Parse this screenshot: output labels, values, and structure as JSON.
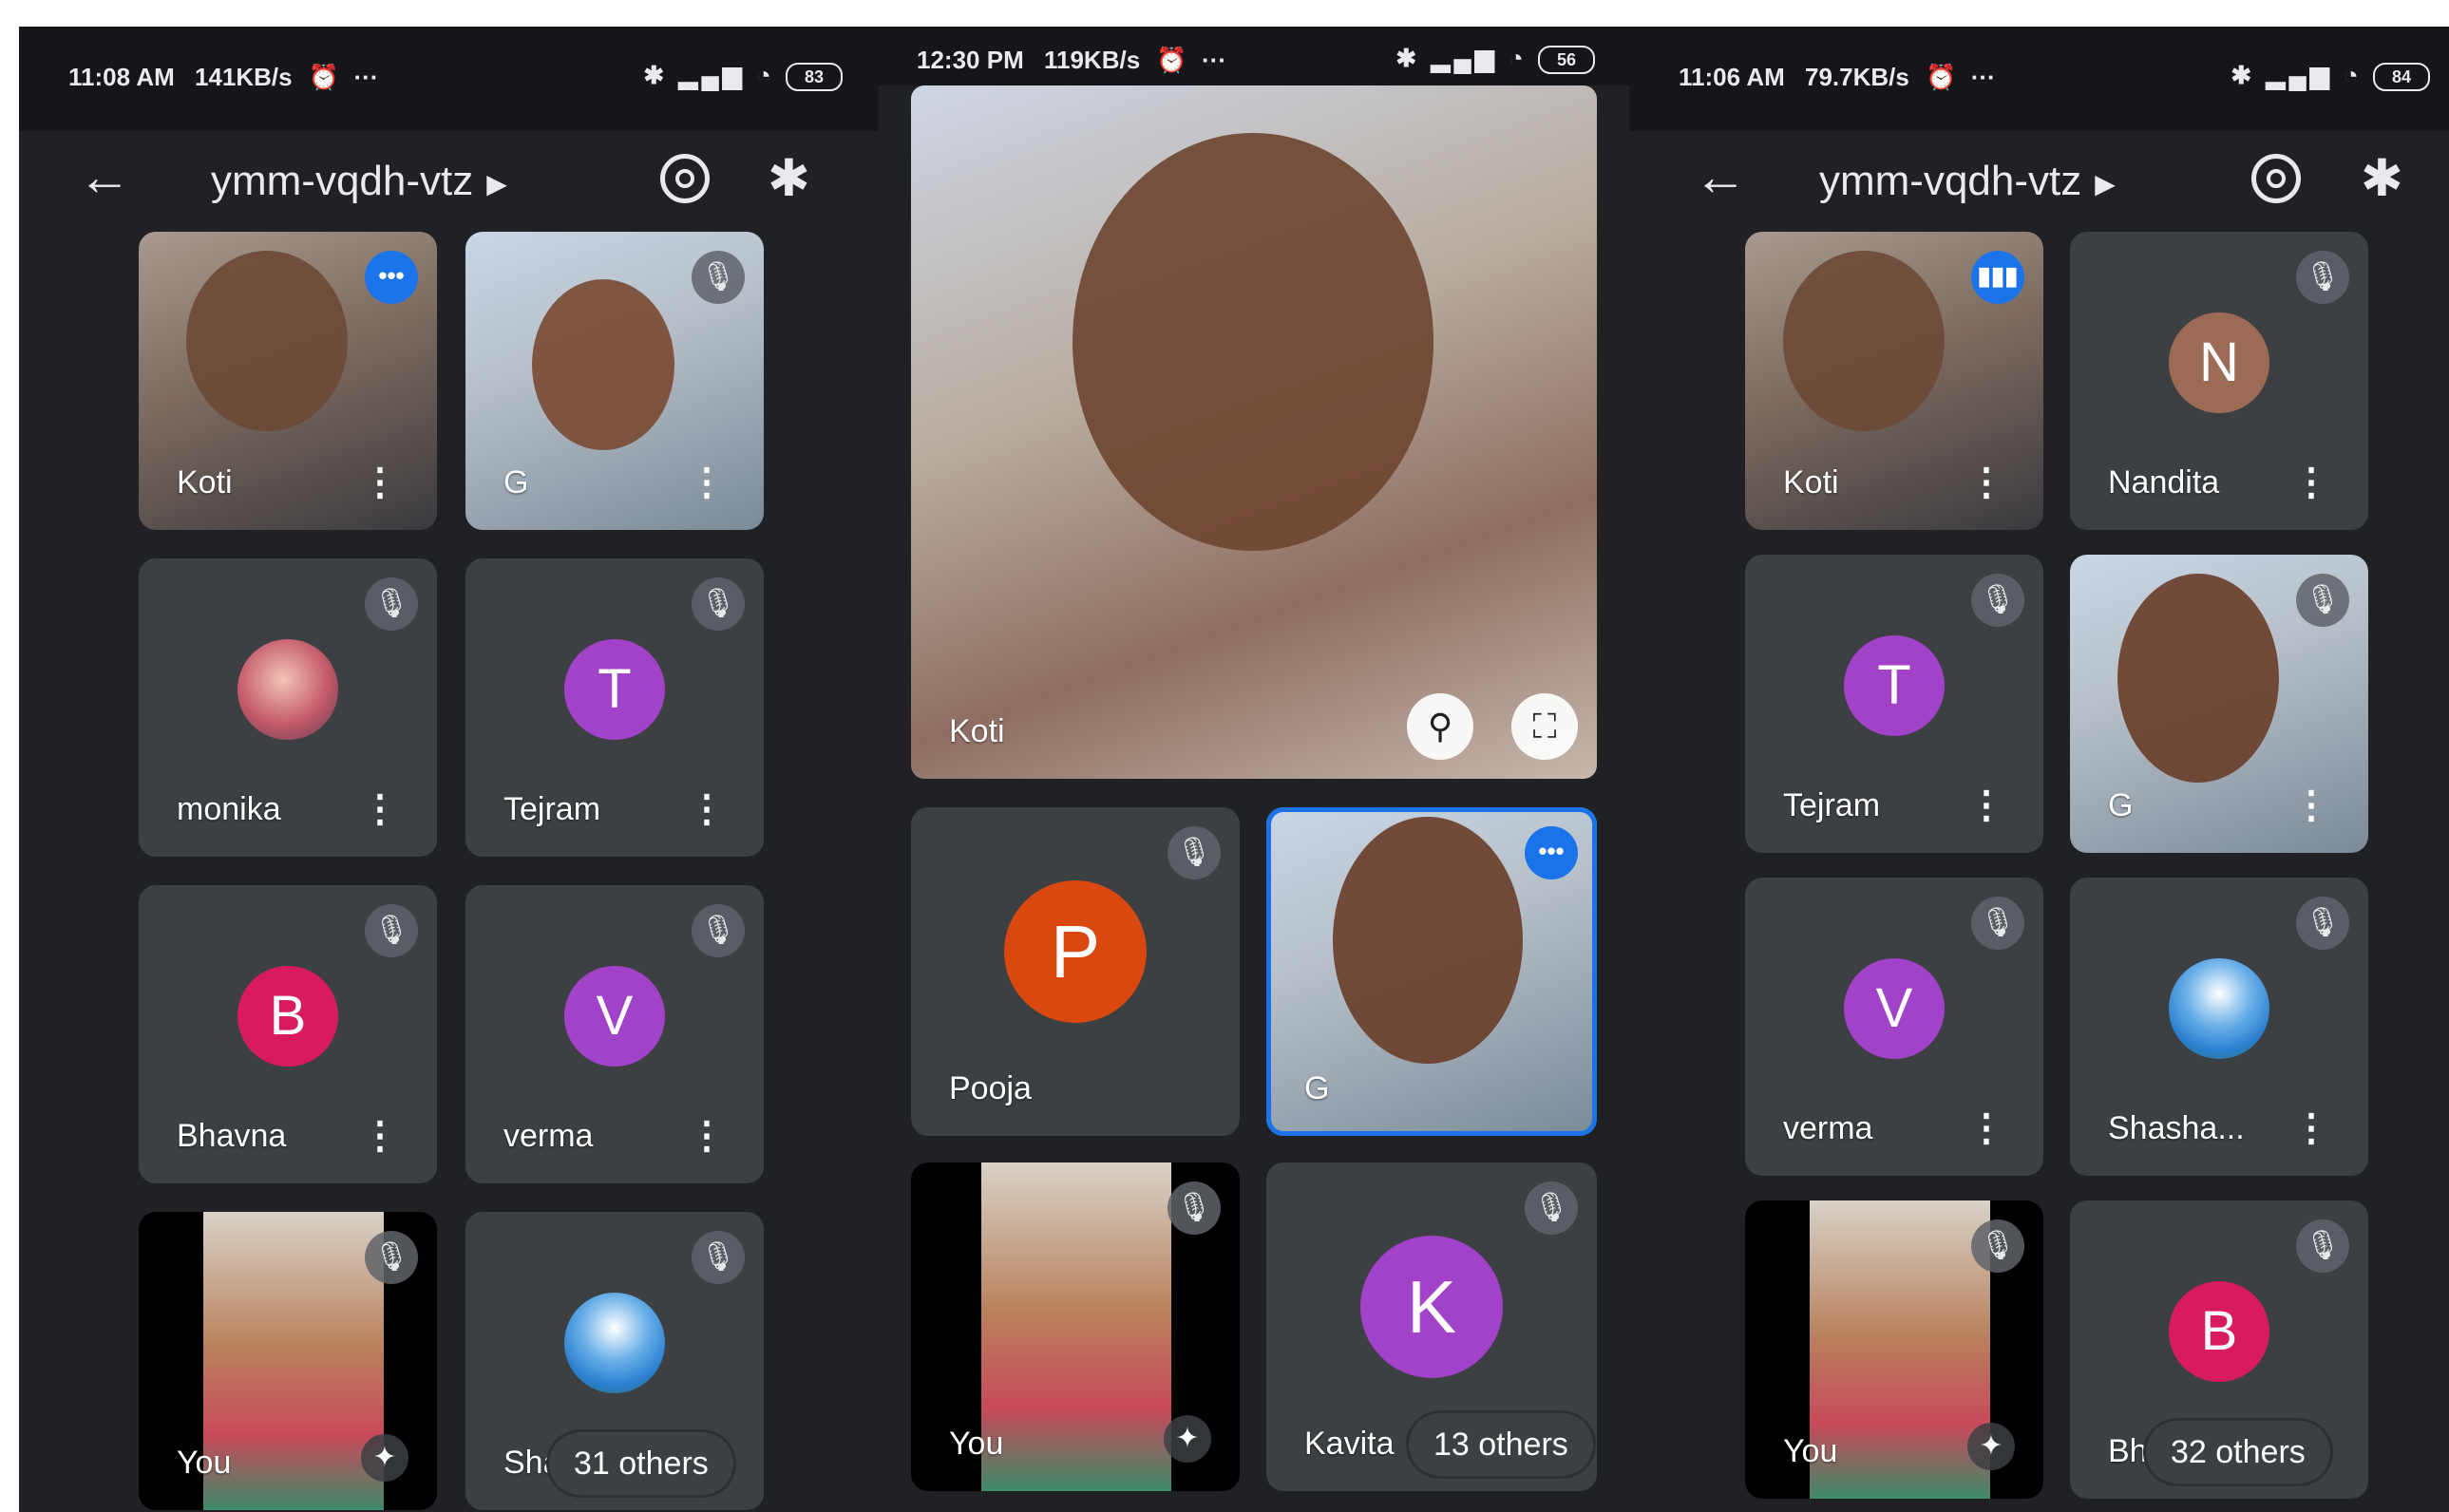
{
  "screens": [
    {
      "status": {
        "time": "11:08 AM",
        "speed": "141KB/s",
        "battery": "83"
      },
      "meeting_code": "ymm-vqdh-vtz",
      "tiles": [
        {
          "name": "Koti"
        },
        {
          "name": "G"
        },
        {
          "name": "monika"
        },
        {
          "name": "Tejram",
          "initial": "T"
        },
        {
          "name": "Bhavna",
          "initial": "B"
        },
        {
          "name": "verma",
          "initial": "V"
        },
        {
          "name": "You"
        },
        {
          "name": "Sha",
          "others": "31 others"
        }
      ]
    },
    {
      "status": {
        "time": "12:30 PM",
        "speed": "119KB/s",
        "battery": "56"
      },
      "tiles": [
        {
          "name": "Koti"
        },
        {
          "name": "Pooja",
          "initial": "P"
        },
        {
          "name": "G"
        },
        {
          "name": "You"
        },
        {
          "name": "Kavita",
          "initial": "K",
          "others": "13 others"
        }
      ]
    },
    {
      "status": {
        "time": "11:06 AM",
        "speed": "79.7KB/s",
        "battery": "84"
      },
      "meeting_code": "ymm-vqdh-vtz",
      "tiles": [
        {
          "name": "Koti"
        },
        {
          "name": "Nandita",
          "initial": "N"
        },
        {
          "name": "Tejram",
          "initial": "T"
        },
        {
          "name": "G"
        },
        {
          "name": "verma",
          "initial": "V"
        },
        {
          "name": "Shasha..."
        },
        {
          "name": "You"
        },
        {
          "name": "Bh",
          "initial": "B",
          "others": "32 others"
        }
      ]
    }
  ],
  "colors": {
    "background": "#202124",
    "tile": "#3c4043",
    "speaking": "#1a73e8",
    "avatar_purple": "#a142c8",
    "avatar_pink": "#d81b60",
    "avatar_orange": "#d9480f",
    "avatar_brown": "#9c6b55"
  },
  "icons": {
    "back": "arrow-left-icon",
    "caret": "caret-right-icon",
    "switch_camera": "switch-camera-icon",
    "bluetooth": "bluetooth-icon",
    "mic_off": "mic-off-icon",
    "speaking": "speaking-indicator-icon",
    "more": "more-vert-icon",
    "effects": "sparkle-icon",
    "unpin": "unpin-icon",
    "fullscreen": "fullscreen-icon"
  }
}
